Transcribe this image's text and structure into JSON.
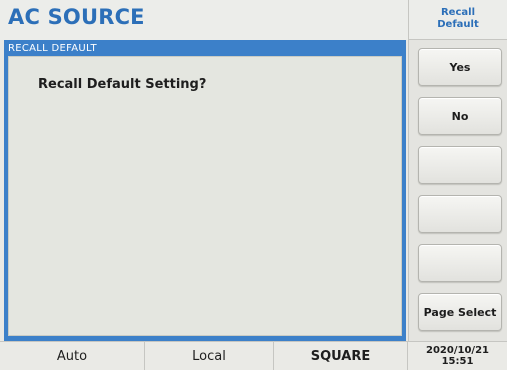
{
  "header": {
    "title": "AC SOURCE"
  },
  "panel": {
    "title": "RECALL DEFAULT",
    "prompt": "Recall Default Setting?"
  },
  "menu": {
    "header_line1": "Recall",
    "header_line2": "Default",
    "softkeys": [
      "Yes",
      "No",
      "",
      "",
      "",
      "Page Select"
    ]
  },
  "status": {
    "mode": "Auto",
    "control": "Local",
    "waveform": "SQUARE",
    "date": "2020/10/21",
    "time": "15:51"
  },
  "colors": {
    "accent_blue": "#3c80c9",
    "title_blue": "#2c6fb8"
  }
}
